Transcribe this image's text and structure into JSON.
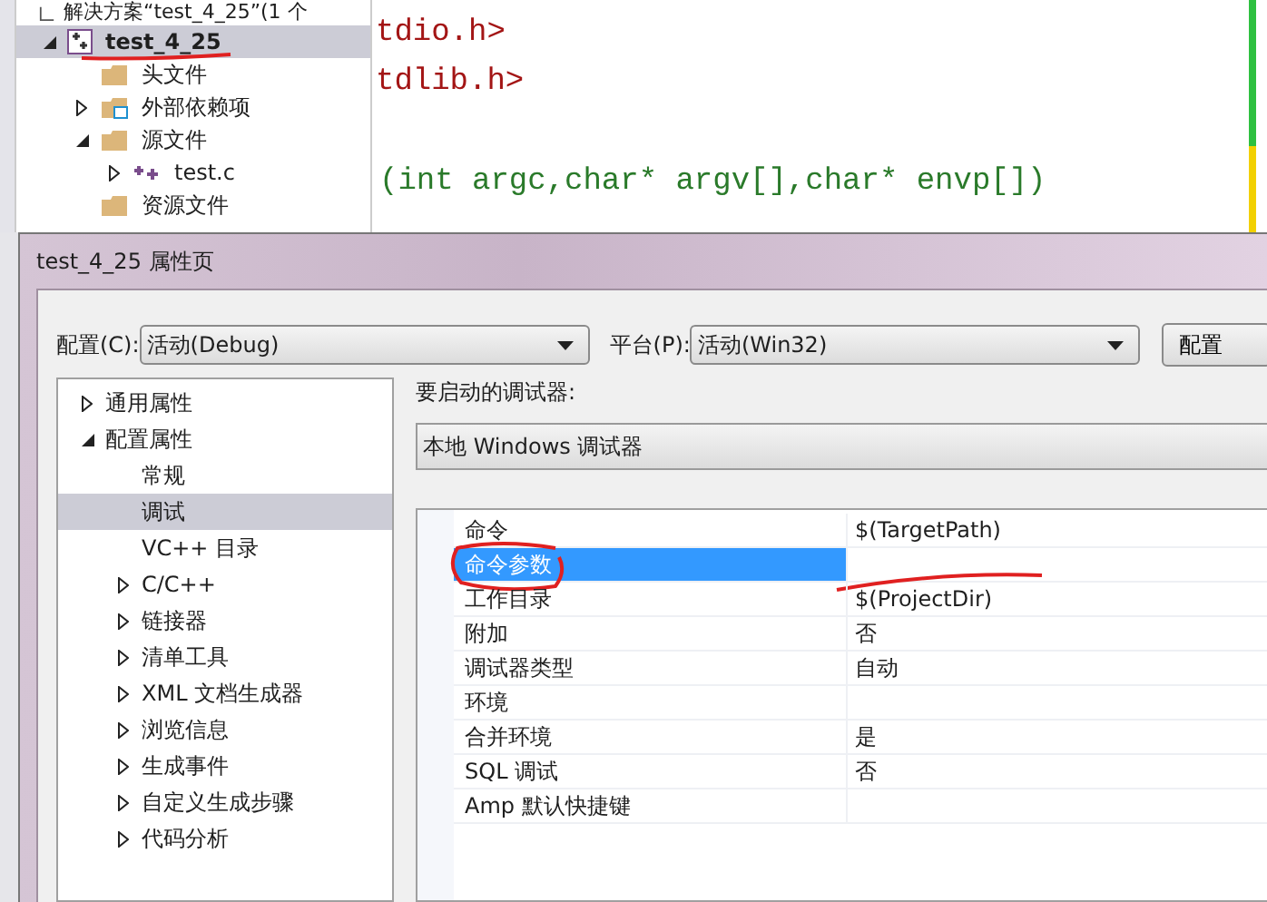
{
  "solution_explorer": {
    "header": "解决方案“test_4_25”(1 个",
    "tree": [
      {
        "label": "test_4_25",
        "kind": "project",
        "selected": true,
        "expanded": true,
        "underlined": true,
        "children": [
          {
            "label": "头文件",
            "kind": "folder",
            "selected": false
          },
          {
            "label": "外部依赖项",
            "kind": "deps",
            "selected": false,
            "expanded": false
          },
          {
            "label": "源文件",
            "kind": "folder",
            "selected": false,
            "expanded": true,
            "children": [
              {
                "label": "test.c",
                "kind": "file",
                "selected": false,
                "expanded": false
              }
            ]
          },
          {
            "label": "资源文件",
            "kind": "folder",
            "selected": false
          }
        ]
      }
    ]
  },
  "editor": {
    "lines": [
      {
        "kind": "include",
        "text": "tdio.h>"
      },
      {
        "kind": "include",
        "text": "tdlib.h>"
      },
      {
        "kind": "code",
        "text": "(int argc,char* argv[],char* envp[])"
      }
    ]
  },
  "dialog": {
    "title": "test_4_25 属性页",
    "config": {
      "label": "配置(C):",
      "value": "活动(Debug)"
    },
    "platform": {
      "label": "平台(P):",
      "value": "活动(Win32)"
    },
    "config_manager_button": "配置",
    "tree": [
      {
        "label": "通用属性",
        "selected": false,
        "expanded": false
      },
      {
        "label": "配置属性",
        "selected": false,
        "expanded": true,
        "children": [
          {
            "label": "常规",
            "selected": false
          },
          {
            "label": "调试",
            "selected": true
          },
          {
            "label": "VC++ 目录",
            "selected": false
          },
          {
            "label": "C/C++",
            "selected": false,
            "expanded": false
          },
          {
            "label": "链接器",
            "selected": false,
            "expanded": false
          },
          {
            "label": "清单工具",
            "selected": false,
            "expanded": false
          },
          {
            "label": "XML 文档生成器",
            "selected": false,
            "expanded": false
          },
          {
            "label": "浏览信息",
            "selected": false,
            "expanded": false
          },
          {
            "label": "生成事件",
            "selected": false,
            "expanded": false
          },
          {
            "label": "自定义生成步骤",
            "selected": false,
            "expanded": false
          },
          {
            "label": "代码分析",
            "selected": false,
            "expanded": false
          }
        ]
      }
    ],
    "debugger_label": "要启动的调试器:",
    "debugger": "本地 Windows 调试器",
    "properties": [
      {
        "name": "命令",
        "value": "$(TargetPath)",
        "selected": false
      },
      {
        "name": "命令参数",
        "selected": true,
        "circled": true
      },
      {
        "name": "工作目录",
        "value": "$(ProjectDir)",
        "selected": false
      },
      {
        "name": "附加",
        "value": "否",
        "selected": false
      },
      {
        "name": "调试器类型",
        "value": "自动",
        "selected": false
      },
      {
        "name": "环境",
        "selected": false
      },
      {
        "name": "合并环境",
        "value": "是",
        "selected": false
      },
      {
        "name": "SQL 调试",
        "value": "否",
        "selected": false
      },
      {
        "name": "Amp 默认快捷键",
        "selected": false
      }
    ]
  }
}
